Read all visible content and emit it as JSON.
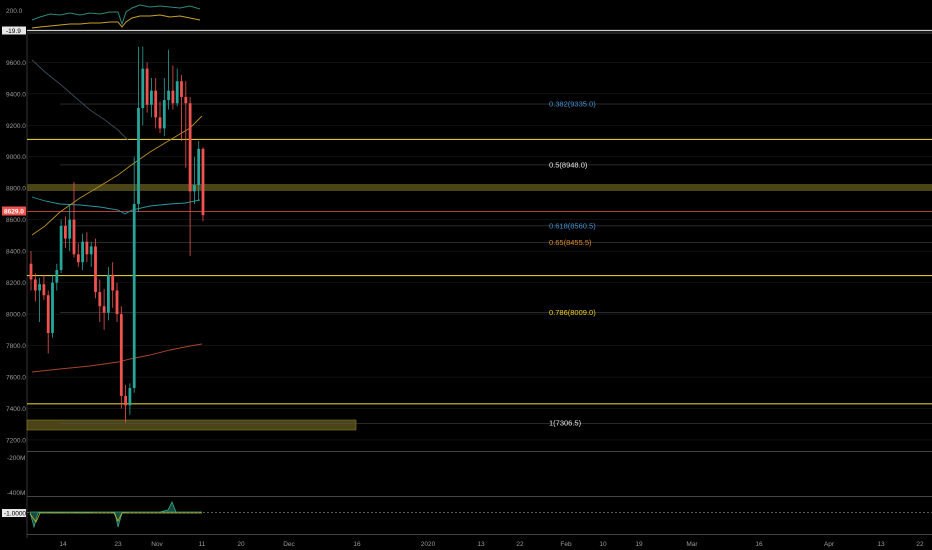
{
  "colors": {
    "background": "#000000",
    "up": "#26a69a",
    "down": "#ef5350",
    "yellow": "#d9c82a",
    "grid": "#1b1b1b"
  },
  "top_pane": {
    "ticks": [
      "200.0"
    ],
    "price_badge": "-19.9"
  },
  "main_pane": {
    "y_ticks": [
      "9600.0",
      "9400.0",
      "9200.0",
      "9000.0",
      "8800.0",
      "8600.0",
      "8400.0",
      "8200.0",
      "8000.0",
      "7800.0",
      "7600.0",
      "7400.0",
      "7200.0"
    ],
    "last_price_label": "8629.0",
    "horizontal_levels": [
      {
        "price": 9110,
        "color": "#d9c82a"
      },
      {
        "price": 8245,
        "color": "#d9c82a"
      },
      {
        "price": 7430,
        "color": "#d9c82a"
      }
    ],
    "fib_levels": [
      {
        "label": "0.382(9335.0)",
        "price": 9335.0,
        "color": "#3f8fd0"
      },
      {
        "label": "0.5(8948.0)",
        "price": 8948.0,
        "color": "#e8e8e8"
      },
      {
        "label": "0.618(8560.5)",
        "price": 8560.5,
        "color": "#3f8fd0"
      },
      {
        "label": "0.65(8455.5)",
        "price": 8455.5,
        "color": "#e08b2a"
      },
      {
        "label": "0.786(8009.0)",
        "price": 8009.0,
        "color": "#f0d020"
      },
      {
        "label": "1(7306.5)",
        "price": 7306.5,
        "color": "#e8e8e8"
      }
    ]
  },
  "volume_pane": {
    "ticks": [
      "-200M",
      "-400M"
    ]
  },
  "osc_pane": {
    "badge": "-1.0000"
  },
  "x_axis": {
    "labels": [
      "14",
      "23",
      "Nov",
      "11",
      "20",
      "Dec",
      "16",
      "2020",
      "13",
      "22",
      "Feb",
      "10",
      "19",
      "Mar",
      "16",
      "Apr",
      "13",
      "22"
    ]
  },
  "chart_data": {
    "type": "candlestick",
    "ohlc": [
      [
        8320,
        8400,
        8150,
        8220
      ],
      [
        8220,
        8260,
        8080,
        8150
      ],
      [
        8150,
        8230,
        7950,
        8190
      ],
      [
        8190,
        8250,
        8090,
        8120
      ],
      [
        8120,
        8150,
        7750,
        7880
      ],
      [
        7880,
        8250,
        7850,
        8200
      ],
      [
        8200,
        8320,
        8150,
        8280
      ],
      [
        8280,
        8600,
        8260,
        8560
      ],
      [
        8560,
        8620,
        8420,
        8480
      ],
      [
        8480,
        8700,
        8400,
        8600
      ],
      [
        8600,
        8840,
        8360,
        8380
      ],
      [
        8380,
        8450,
        8300,
        8330
      ],
      [
        8330,
        8510,
        8280,
        8460
      ],
      [
        8460,
        8520,
        8330,
        8380
      ],
      [
        8380,
        8460,
        8300,
        8430
      ],
      [
        8430,
        8480,
        8100,
        8140
      ],
      [
        8140,
        8220,
        7950,
        8050
      ],
      [
        8050,
        8160,
        7900,
        8010
      ],
      [
        8010,
        8300,
        7960,
        8250
      ],
      [
        8250,
        8330,
        8040,
        8150
      ],
      [
        8150,
        8200,
        7950,
        8000
      ],
      [
        8000,
        8050,
        7400,
        7480
      ],
      [
        7480,
        7550,
        7310,
        7420
      ],
      [
        7420,
        7560,
        7360,
        7530
      ],
      [
        7530,
        9000,
        7500,
        8700
      ],
      [
        8700,
        9700,
        8650,
        9310
      ],
      [
        9310,
        9700,
        9200,
        9560
      ],
      [
        9560,
        9600,
        9280,
        9330
      ],
      [
        9330,
        9500,
        9250,
        9420
      ],
      [
        9420,
        9500,
        9180,
        9250
      ],
      [
        9250,
        9350,
        9150,
        9180
      ],
      [
        9180,
        9500,
        9130,
        9360
      ],
      [
        9360,
        9680,
        9300,
        9420
      ],
      [
        9420,
        9580,
        9300,
        9340
      ],
      [
        9340,
        9560,
        9320,
        9480
      ],
      [
        9480,
        9520,
        9100,
        9380
      ],
      [
        9380,
        9480,
        8930,
        9340
      ],
      [
        9340,
        9380,
        8370,
        8780
      ],
      [
        8780,
        9000,
        8700,
        8820
      ],
      [
        8820,
        9100,
        8720,
        9050
      ],
      [
        9050,
        9060,
        8590,
        8629
      ]
    ],
    "ylim": [
      7130,
      9780
    ],
    "dates_start": "Oct 7"
  }
}
